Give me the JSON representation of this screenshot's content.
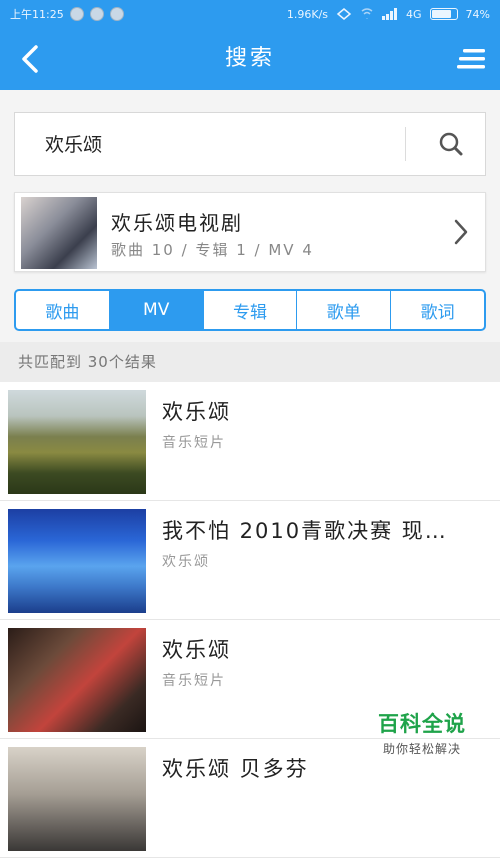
{
  "status_bar": {
    "time": "上午11:25",
    "network_speed": "1.96K/s",
    "signal_type": "4G",
    "battery": "74%"
  },
  "header": {
    "title": "搜索"
  },
  "search": {
    "value": "欢乐颂"
  },
  "artist_card": {
    "title": "欢乐颂电视剧",
    "stats": "歌曲 10 / 专辑 1 / MV 4"
  },
  "tabs": [
    {
      "label": "歌曲",
      "active": false
    },
    {
      "label": "MV",
      "active": true
    },
    {
      "label": "专辑",
      "active": false
    },
    {
      "label": "歌单",
      "active": false
    },
    {
      "label": "歌词",
      "active": false
    }
  ],
  "result_count": "共匹配到 30个结果",
  "results": [
    {
      "title": "欢乐颂",
      "subtitle": "音乐短片"
    },
    {
      "title": "我不怕 2010青歌决赛 现…",
      "subtitle": "欢乐颂"
    },
    {
      "title": "欢乐颂",
      "subtitle": "音乐短片"
    },
    {
      "title": "欢乐颂 贝多芬",
      "subtitle": ""
    }
  ],
  "watermark": {
    "title": "百科全说",
    "subtitle": "助你轻松解决"
  },
  "colors": {
    "primary": "#2d9bef",
    "watermark_green": "#1fa34a"
  }
}
